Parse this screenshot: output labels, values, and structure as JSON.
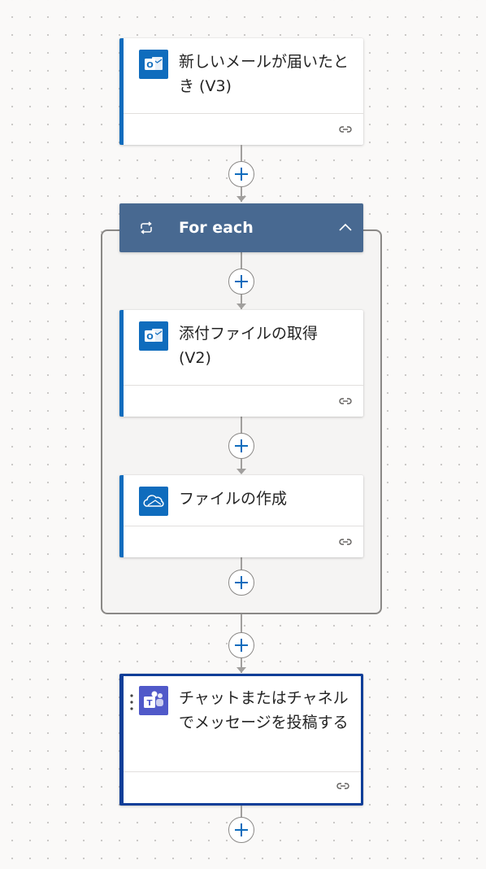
{
  "steps": [
    {
      "title": "新しいメールが届いたとき (V3)",
      "icon": "outlook-icon",
      "accent": "#0f6cbd"
    },
    {
      "title": "For each",
      "icon": "loop-icon",
      "color": "#486991",
      "children": [
        {
          "title": "添付ファイルの取得 (V2)",
          "icon": "outlook-icon",
          "accent": "#0f6cbd"
        },
        {
          "title": "ファイルの作成",
          "icon": "onedrive-icon",
          "accent": "#0f6cbd"
        }
      ]
    },
    {
      "title": "チャットまたはチャネルでメッセージを投稿する",
      "icon": "teams-icon",
      "accent": "#0f6cbd",
      "selected": true
    }
  ],
  "colors": {
    "outlook_blue": "#0f6cbd",
    "teams_purple": "#5059c9",
    "foreach_header": "#486991",
    "selected_border": "#0f3e98",
    "connector": "#a19f9d"
  }
}
